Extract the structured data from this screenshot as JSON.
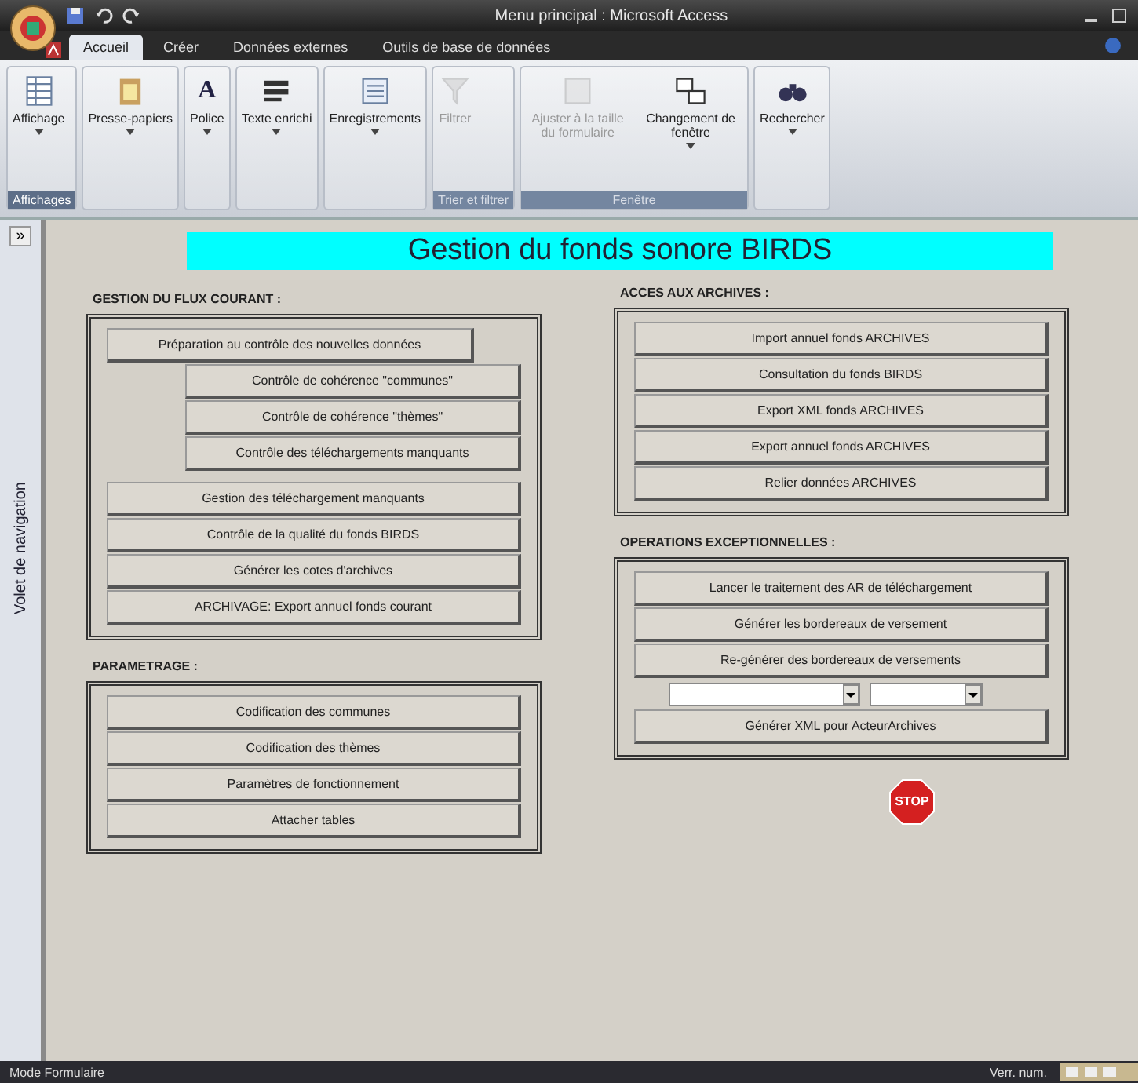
{
  "window": {
    "title": "Menu principal : Microsoft Access"
  },
  "tabs": [
    {
      "label": "Accueil",
      "selected": true
    },
    {
      "label": "Créer",
      "selected": false
    },
    {
      "label": "Données externes",
      "selected": false
    },
    {
      "label": "Outils de base de données",
      "selected": false
    }
  ],
  "ribbon": [
    {
      "label": "Affichages",
      "disabled": false,
      "items": [
        {
          "label": "Affichage",
          "kind": "table",
          "disabled": false,
          "dropdown": true
        }
      ]
    },
    {
      "items": [
        {
          "label": "Presse-papiers",
          "kind": "clipboard",
          "disabled": false,
          "dropdown": true
        }
      ]
    },
    {
      "items": [
        {
          "label": "Police",
          "kind": "letter",
          "glyph": "A",
          "disabled": false,
          "dropdown": true
        }
      ]
    },
    {
      "items": [
        {
          "label": "Texte enrichi",
          "kind": "lines",
          "disabled": false,
          "dropdown": true
        }
      ]
    },
    {
      "items": [
        {
          "label": "Enregistrements",
          "kind": "records",
          "disabled": false,
          "dropdown": true
        }
      ]
    },
    {
      "label": "Trier et filtrer",
      "disabled": true,
      "items": [
        {
          "label": "Filtrer",
          "kind": "filter",
          "disabled": true,
          "dropdown": false
        }
      ]
    },
    {
      "label": "Fenêtre",
      "disabled": true,
      "items": [
        {
          "label": "Ajuster à la taille du formulaire",
          "kind": "window",
          "disabled": true,
          "dropdown": false
        },
        {
          "label": "Changement de fenêtre",
          "kind": "windows",
          "disabled": false,
          "dropdown": true
        }
      ]
    },
    {
      "items": [
        {
          "label": "Rechercher",
          "kind": "binoculars",
          "disabled": false,
          "dropdown": true
        }
      ]
    }
  ],
  "nav_pane": {
    "toggle": "»",
    "label": "Volet de navigation"
  },
  "form": {
    "title": "Gestion du fonds sonore BIRDS",
    "left": [
      {
        "title": "GESTION DU FLUX COURANT :",
        "buttons": [
          "Préparation au contrôle des nouvelles données",
          "Contrôle de cohérence \"communes\"",
          "Contrôle de cohérence \"thèmes\"",
          "Contrôle des téléchargements manquants",
          "Gestion des téléchargement manquants",
          "Contrôle de la qualité du fonds BIRDS",
          "Générer les cotes d'archives",
          "ARCHIVAGE: Export annuel fonds courant"
        ]
      },
      {
        "title": "PARAMETRAGE :",
        "buttons": [
          "Codification des communes",
          "Codification des thèmes",
          "Paramètres de fonctionnement",
          "Attacher tables"
        ]
      }
    ],
    "right": [
      {
        "title": "ACCES AUX ARCHIVES :",
        "buttons": [
          "Import annuel fonds ARCHIVES",
          "Consultation du fonds BIRDS",
          "Export XML fonds ARCHIVES",
          "Export annuel fonds ARCHIVES",
          "Relier données ARCHIVES"
        ]
      },
      {
        "title": "OPERATIONS EXCEPTIONNELLES :",
        "buttons": [
          "Lancer le traitement des AR de téléchargement",
          "Générer les bordereaux de versement",
          "Re-générer des bordereaux de versements"
        ],
        "combos": [
          {
            "kind": "combo"
          },
          {
            "kind": "combo"
          }
        ],
        "after": [
          "Générer XML pour ActeurArchives"
        ]
      }
    ],
    "stop": "STOP"
  },
  "status_bar": {
    "left": "Mode Formulaire",
    "right": "Verr. num."
  }
}
